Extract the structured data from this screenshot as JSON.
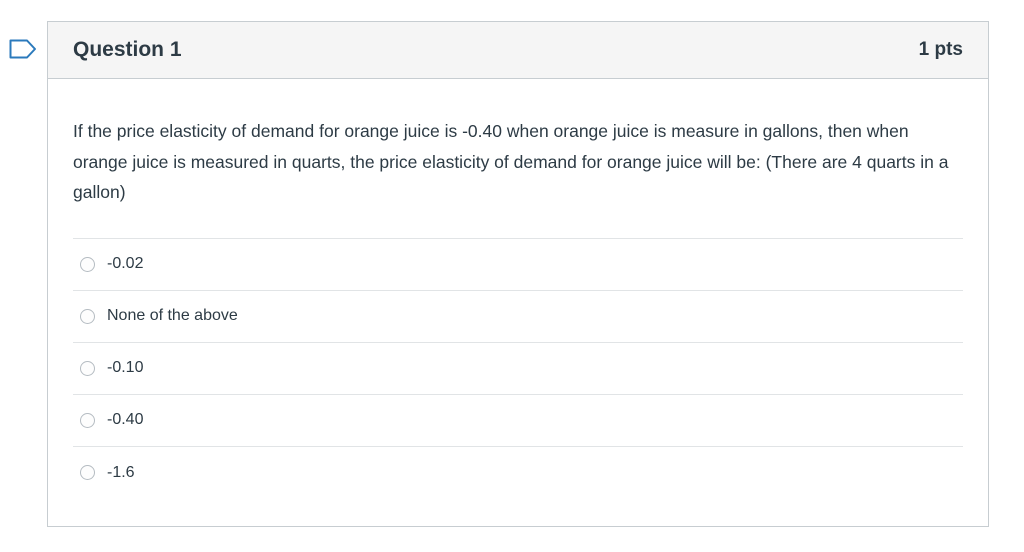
{
  "question": {
    "title": "Question 1",
    "points": "1 pts",
    "text": "If the price elasticity of demand for orange juice is -0.40 when orange juice is measure in gallons, then when orange juice is measured in quarts, the price elasticity of demand for orange juice will be: (There are 4 quarts in a gallon)",
    "flag_icon": "flag-icon",
    "answers": [
      {
        "label": "-0.02"
      },
      {
        "label": "None of the above"
      },
      {
        "label": "-0.10"
      },
      {
        "label": "-0.40"
      },
      {
        "label": "-1.6"
      }
    ]
  },
  "colors": {
    "flag": "#2b7abc",
    "header_bg": "#f5f5f5",
    "border": "#c7cdd1",
    "text": "#2d3b45"
  }
}
